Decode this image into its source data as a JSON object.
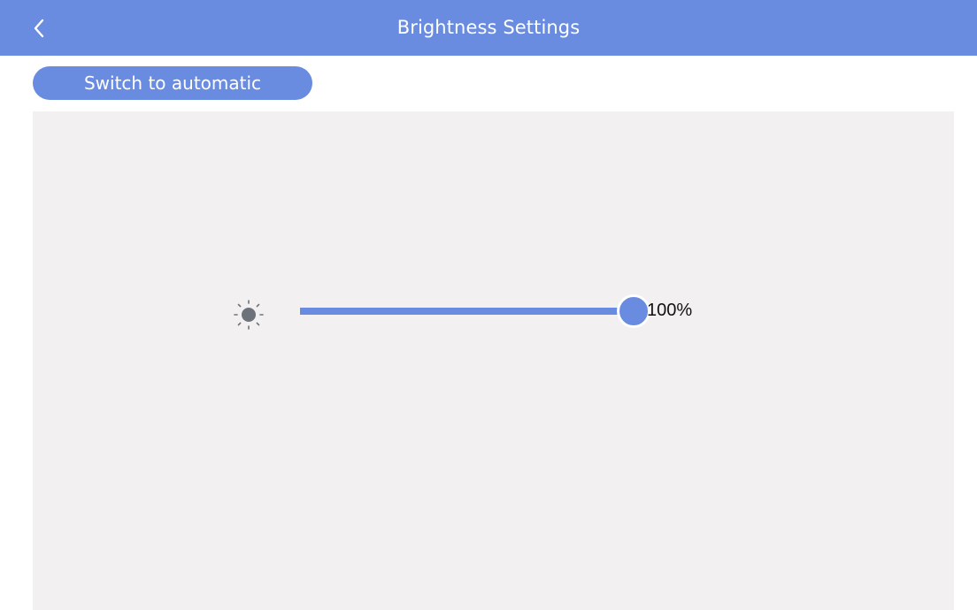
{
  "header": {
    "title": "Brightness Settings",
    "back_icon": "chevron-left-icon"
  },
  "auto_button": {
    "label": "Switch to automatic"
  },
  "brightness": {
    "icon": "sun-icon",
    "level": 1.0,
    "value_label": "100%"
  },
  "colors": {
    "accent": "#6a8ce0",
    "panel_bg": "#f2f0f1",
    "text_dark": "#111111",
    "icon_gray": "#6e737b"
  }
}
